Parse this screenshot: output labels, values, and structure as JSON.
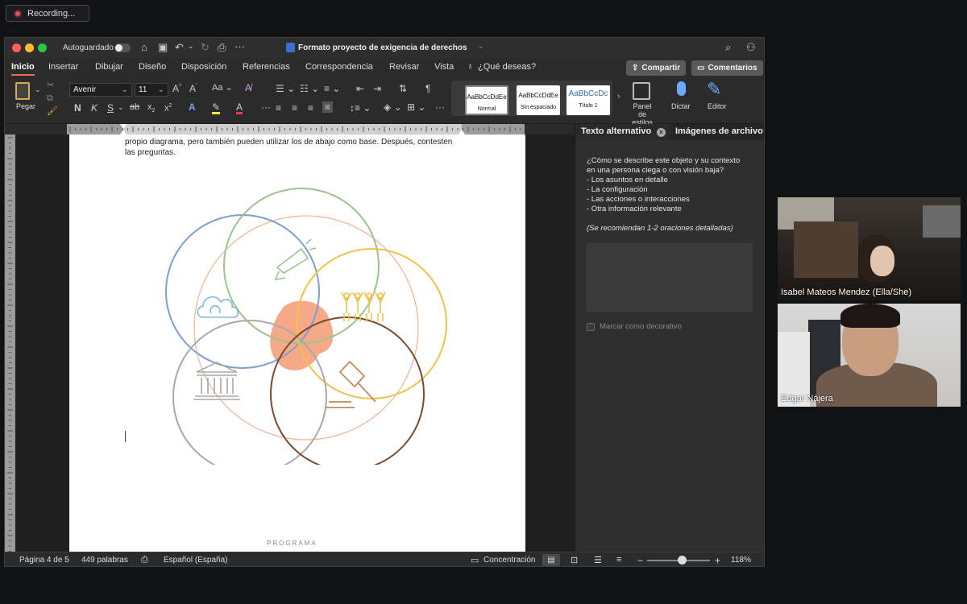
{
  "recording": {
    "label": "Recording..."
  },
  "titlebar": {
    "autosave_label": "Autoguardado",
    "document_title": "Formato proyecto de exigencia de derechos"
  },
  "tabs": [
    "Inicio",
    "Insertar",
    "Dibujar",
    "Diseño",
    "Disposición",
    "Referencias",
    "Correspondencia",
    "Revisar",
    "Vista"
  ],
  "tell_me": "¿Qué deseas?",
  "share_label": "Compartir",
  "comments_label": "Comentarios",
  "ribbon": {
    "paste_label": "Pegar",
    "font_name": "Avenir",
    "font_size": "11",
    "styles": [
      {
        "preview": "AaBbCcDdEe",
        "name": "Normal"
      },
      {
        "preview": "AaBbCcDdEe",
        "name": "Sin espaciado"
      },
      {
        "preview": "AaBbCcDc",
        "name": "Título 1"
      }
    ],
    "styles_pane_label": "Panel de estilos",
    "dictate_label": "Dictar",
    "editor_label": "Editor"
  },
  "document": {
    "line1": "propio diagrama, pero también pueden utilizar los de abajo como base. Después, contesten",
    "line2": "las preguntas.",
    "footer_text": "PROGRAMA"
  },
  "sidepanel": {
    "tab_alt": "Texto alternativo",
    "tab_images": "Imágenes de archivo",
    "question_l1": "¿Cómo se describe este objeto y su contexto",
    "question_l2": "en una persona ciega o con visión baja?",
    "bullets": [
      "- Los asuntos en detalle",
      "- La configuración",
      "- Las acciones o interacciones",
      "- Otra información relevante"
    ],
    "recommendation": "(Se recomiendan 1-2 oraciones detalladas)",
    "decorative_label": "Marcar como decorativo"
  },
  "statusbar": {
    "page": "Página 4 de 5",
    "words": "449 palabras",
    "language": "Español (España)",
    "focus": "Concentración",
    "zoom": "118%",
    "zoom_level": 0.55
  },
  "participants": [
    {
      "name": "Isabel Mateos Mendez (Ella/She)"
    },
    {
      "name": "Edgar Nájera"
    }
  ],
  "colors": {
    "accent": "#e86e4d",
    "circle_blue": "#7d9fd0",
    "circle_green": "#9cc48e",
    "circle_yellow": "#f0c24a",
    "circle_gray": "#a9a9a9",
    "circle_brown": "#7a4a2a",
    "circle_peach": "#f0b898",
    "blob": "#f4a07a"
  }
}
